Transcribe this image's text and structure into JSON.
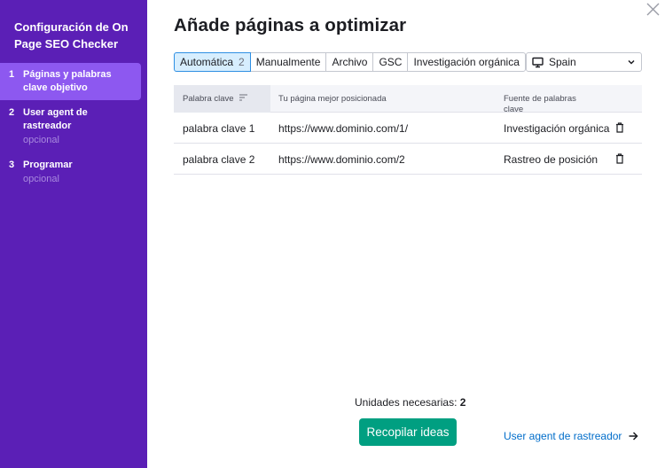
{
  "sidebar": {
    "title": "Configuración de On Page SEO Checker",
    "steps": [
      {
        "number": "1",
        "label": "Páginas y palabras clave objetivo",
        "sub": ""
      },
      {
        "number": "2",
        "label": "User agent de rastreador",
        "sub": "opcional"
      },
      {
        "number": "3",
        "label": "Programar",
        "sub": "opcional"
      }
    ]
  },
  "main": {
    "title": "Añade páginas a optimizar",
    "tabs": [
      {
        "label": "Automática",
        "count": "2",
        "active": true
      },
      {
        "label": "Manualmente"
      },
      {
        "label": "Archivo"
      },
      {
        "label": "GSC"
      },
      {
        "label": "Investigación orgánica"
      }
    ],
    "country": {
      "value": "Spain",
      "icon": "monitor-icon"
    },
    "table": {
      "columns": [
        "Palabra clave",
        "Tu página mejor posicionada",
        "Fuente de palabras clave"
      ],
      "rows": [
        {
          "keyword": "palabra clave 1",
          "url": "https://www.dominio.com/1/",
          "source": "Investigación orgánica"
        },
        {
          "keyword": "palabra clave 2",
          "url": "https://www.dominio.com/2",
          "source": "Rastreo de posición"
        }
      ]
    },
    "units_label": "Unidades necesarias:",
    "units_value": "2",
    "collect_button": "Recopilar ideas",
    "next_link": "User agent de rastreador"
  },
  "colors": {
    "sidebar": "#5b1fb6",
    "active_step": "#8d58f0",
    "primary_button": "#009f81",
    "link": "#006dca",
    "active_tab": "#d7eefe"
  }
}
